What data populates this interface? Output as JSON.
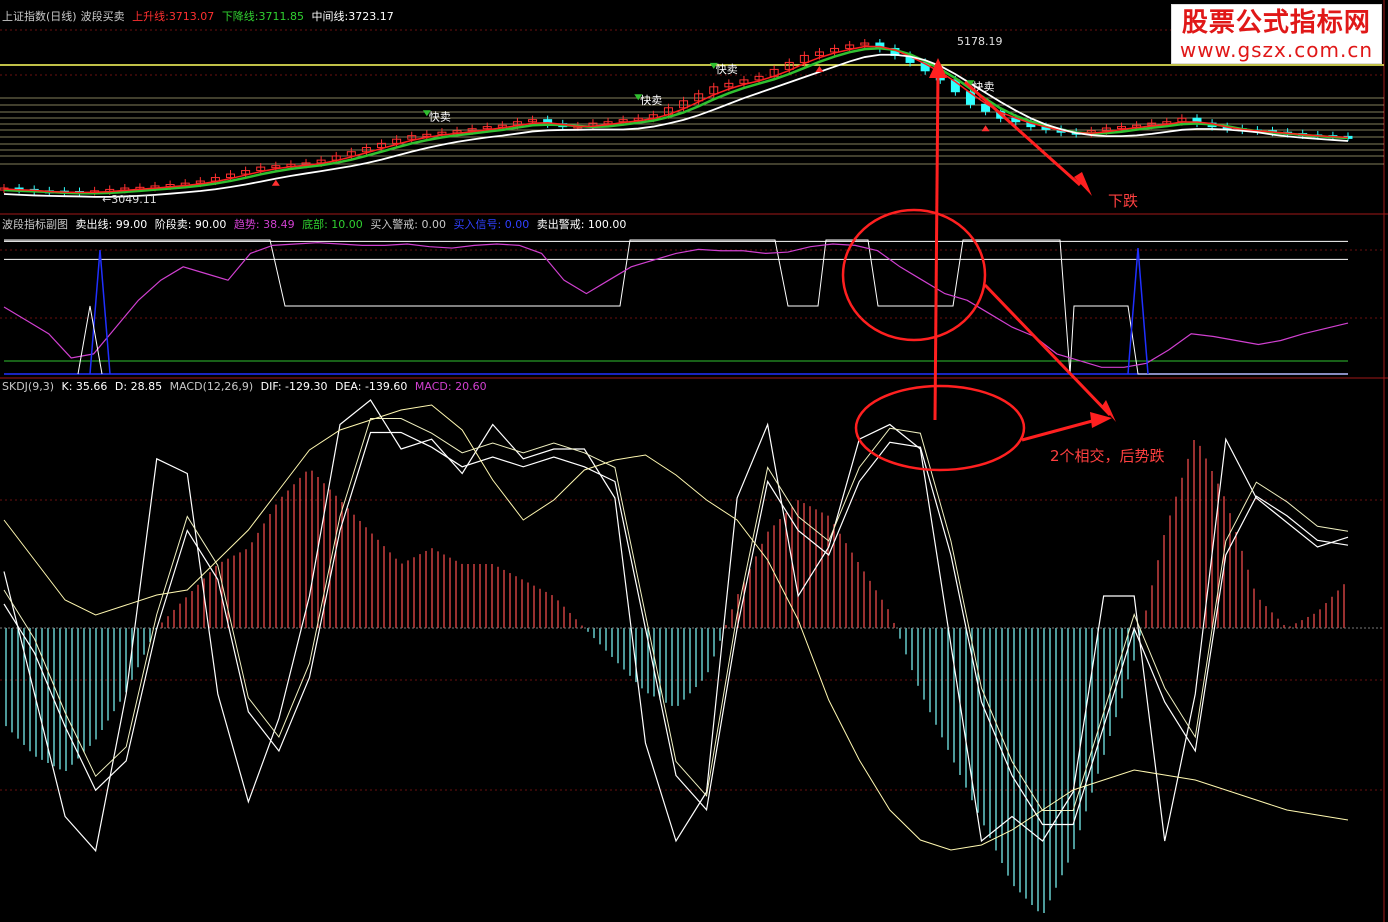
{
  "header_main": {
    "title": "上证指数(日线)",
    "indicator": "波段买卖",
    "up_label": "上升线:",
    "up_value": "3713.07",
    "down_label": "下降线:",
    "down_value": "3711.85",
    "mid_label": "中间线:",
    "mid_value": "3723.17"
  },
  "header_sub": {
    "name": "波段指标副图",
    "sell_line": "卖出线: 99.00",
    "stage_sell": "阶段卖: 90.00",
    "trend": "趋势: 38.49",
    "bottom": "底部: 10.00",
    "buy_warn": "买入警戒: 0.00",
    "buy_signal": "买入信号: 0.00",
    "sell_warn": "卖出警戒: 100.00"
  },
  "header_macd": {
    "skdj": "SKDJ(9,3)",
    "k": "K: 35.66",
    "d": "D: 28.85",
    "macd_name": "MACD(12,26,9)",
    "dif": "DIF: -129.30",
    "dea": "DEA: -139.60",
    "macd": "MACD: 20.60"
  },
  "watermark": {
    "line1": "股票公式指标网",
    "line2": "www.gszx.com.cn"
  },
  "annotations": {
    "low_price": "3049.11",
    "high_price": "5178.19",
    "fast_sell": "快卖",
    "drop_label": "下跌",
    "cross_label": "2个相交，后势跌"
  },
  "colors": {
    "up": "#ff3030",
    "down": "#30ffff",
    "yellow": "#ffff40",
    "white": "#ffffff",
    "green": "#30c030",
    "magenta": "#d040d0",
    "blue": "#2030ff",
    "red": "#ff2020"
  },
  "chart_data": [
    {
      "type": "line",
      "panel": "main",
      "price_labels": {
        "low": 3049.11,
        "high": 5178.19
      },
      "series": [
        {
          "name": "上升线",
          "last": 3713.07
        },
        {
          "name": "下降线",
          "last": 3711.85
        },
        {
          "name": "中间线",
          "last": 3723.17
        }
      ],
      "close": [
        3100,
        3080,
        3060,
        3055,
        3050,
        3049,
        3060,
        3080,
        3100,
        3110,
        3130,
        3150,
        3170,
        3200,
        3250,
        3300,
        3350,
        3400,
        3420,
        3440,
        3460,
        3500,
        3560,
        3620,
        3680,
        3740,
        3800,
        3850,
        3870,
        3900,
        3920,
        3950,
        3980,
        4000,
        4050,
        4080,
        4020,
        3980,
        3990,
        4030,
        4050,
        4080,
        4100,
        4150,
        4250,
        4350,
        4450,
        4550,
        4600,
        4650,
        4700,
        4800,
        4900,
        5000,
        5050,
        5100,
        5150,
        5178,
        5100,
        5000,
        4900,
        4780,
        4650,
        4480,
        4300,
        4200,
        4100,
        4050,
        3980,
        3940,
        3900,
        3880,
        3920,
        3960,
        3980,
        4000,
        4030,
        4050,
        4100,
        4030,
        3980,
        3950,
        3930,
        3920,
        3900,
        3880,
        3860,
        3850,
        3840,
        3830
      ]
    },
    {
      "type": "line",
      "panel": "sub",
      "ylim": [
        0,
        100
      ],
      "series": [
        {
          "name": "趋势",
          "values": [
            50,
            40,
            30,
            12,
            15,
            35,
            55,
            70,
            80,
            75,
            70,
            90,
            96,
            97,
            98,
            97,
            96,
            96,
            97,
            95,
            94,
            96,
            97,
            96,
            90,
            70,
            60,
            70,
            80,
            85,
            90,
            93,
            92,
            92,
            90,
            91,
            95,
            97,
            96,
            92,
            80,
            70,
            60,
            55,
            45,
            35,
            28,
            15,
            10,
            5,
            5,
            8,
            18,
            30,
            28,
            25,
            22,
            25,
            30,
            34,
            38
          ]
        }
      ]
    },
    {
      "type": "line",
      "panel": "macd",
      "series": [
        {
          "name": "K",
          "values": [
            65,
            40,
            15,
            8,
            40,
            88,
            85,
            40,
            18,
            35,
            60,
            95,
            100,
            90,
            92,
            85,
            95,
            88,
            90,
            90,
            80,
            30,
            10,
            20,
            80,
            95,
            60,
            70,
            92,
            95,
            90,
            50,
            10,
            15,
            10,
            20,
            60,
            60,
            10,
            40,
            92,
            80,
            75,
            70,
            72
          ]
        },
        {
          "name": "D",
          "values": [
            60,
            50,
            35,
            22,
            28,
            55,
            75,
            65,
            38,
            30,
            45,
            75,
            95,
            95,
            92,
            88,
            90,
            88,
            90,
            88,
            85,
            55,
            25,
            18,
            55,
            85,
            75,
            70,
            85,
            93,
            92,
            70,
            40,
            25,
            15,
            15,
            35,
            55,
            40,
            30,
            70,
            82,
            78,
            73,
            72
          ]
        },
        {
          "name": "MACD",
          "values": [
            -30,
            -40,
            -45,
            -35,
            -20,
            0,
            10,
            20,
            25,
            40,
            50,
            40,
            30,
            20,
            25,
            20,
            20,
            15,
            10,
            0,
            -10,
            -20,
            -25,
            -15,
            10,
            30,
            40,
            35,
            20,
            5,
            -20,
            -40,
            -60,
            -80,
            -90,
            -70,
            -40,
            -10,
            30,
            60,
            40,
            10,
            0,
            5,
            15
          ]
        }
      ]
    }
  ]
}
